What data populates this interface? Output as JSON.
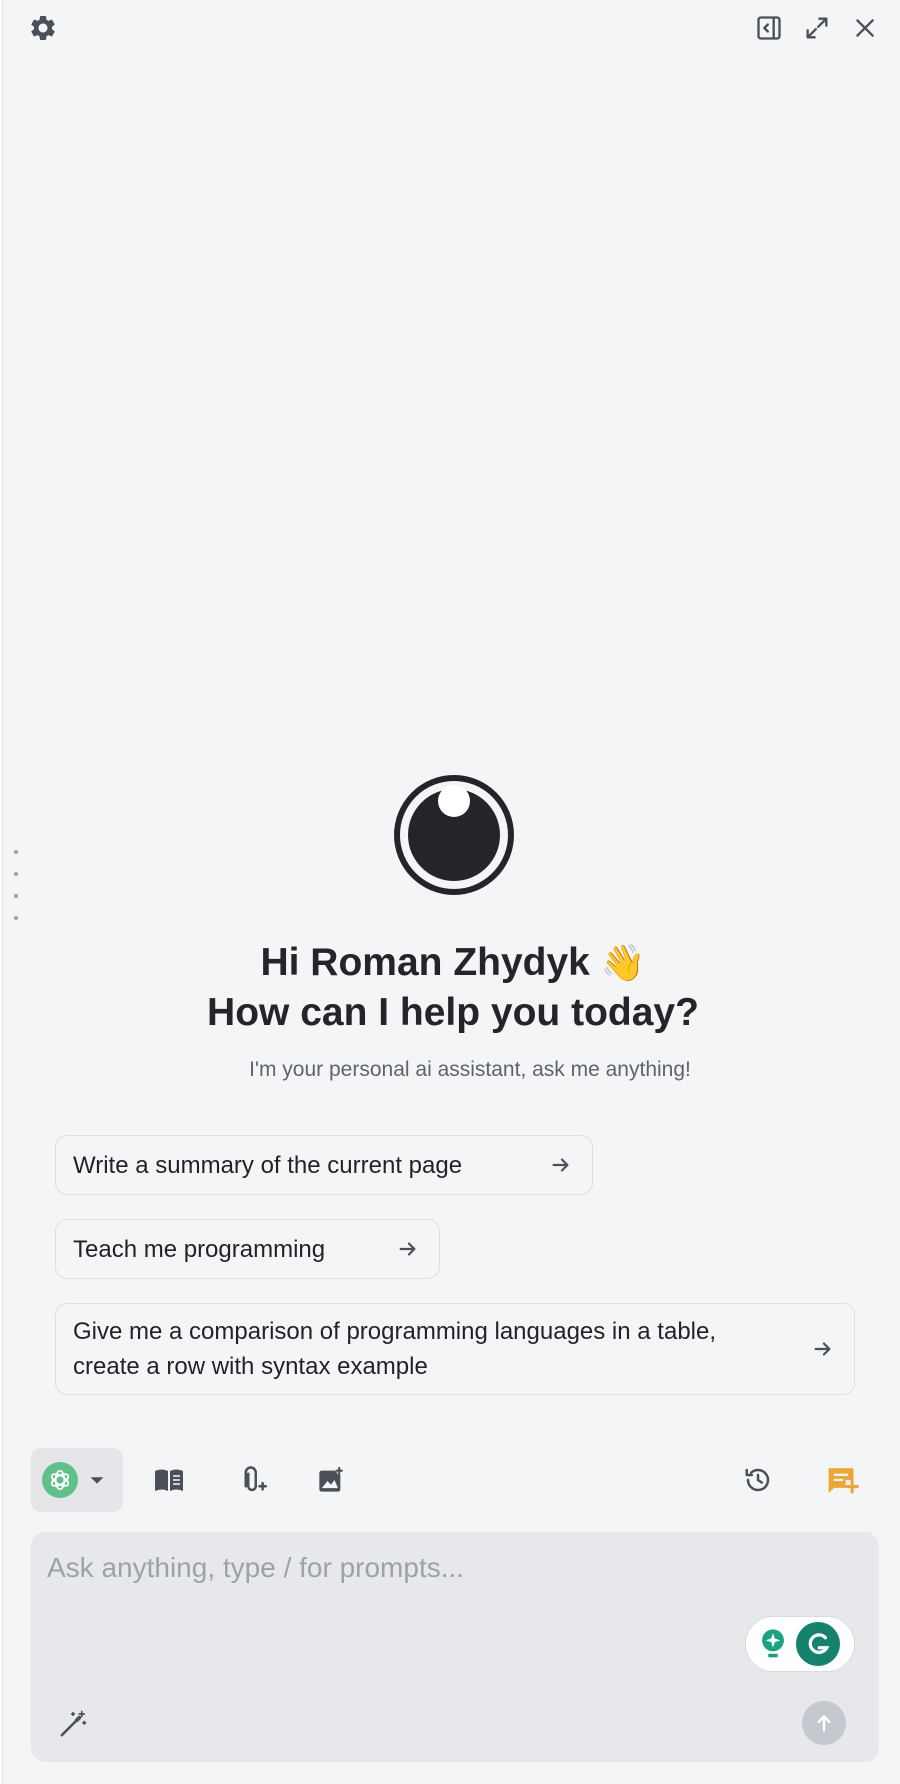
{
  "header": {
    "icons": [
      "gear-icon",
      "sidebar-toggle-icon",
      "expand-icon",
      "close-icon"
    ]
  },
  "assistant": {
    "greeting_line1": "Hi Roman Zhydyk",
    "wave_emoji": "👋",
    "greeting_line2": "How can I help you today?",
    "subtitle": "I'm your personal ai assistant, ask me anything!"
  },
  "suggestions": [
    {
      "label": "Write a summary of the current page"
    },
    {
      "label": "Teach me programming"
    },
    {
      "label": "Give me a comparison of programming languages in a table, create a row with syntax example"
    }
  ],
  "toolbar": {
    "model_icon": "openai-icon",
    "tools": [
      "book-icon",
      "attach-icon",
      "image-add-icon"
    ],
    "right_tools": [
      "history-icon",
      "new-chat-icon"
    ],
    "accent_color": "#f0a431"
  },
  "composer": {
    "placeholder": "Ask anything, type / for prompts...",
    "value": ""
  },
  "colors": {
    "background": "#f4f5f7",
    "input_bg": "#e6e8ec",
    "model_green": "#5fc08a",
    "grammarly_green": "#15826d"
  }
}
